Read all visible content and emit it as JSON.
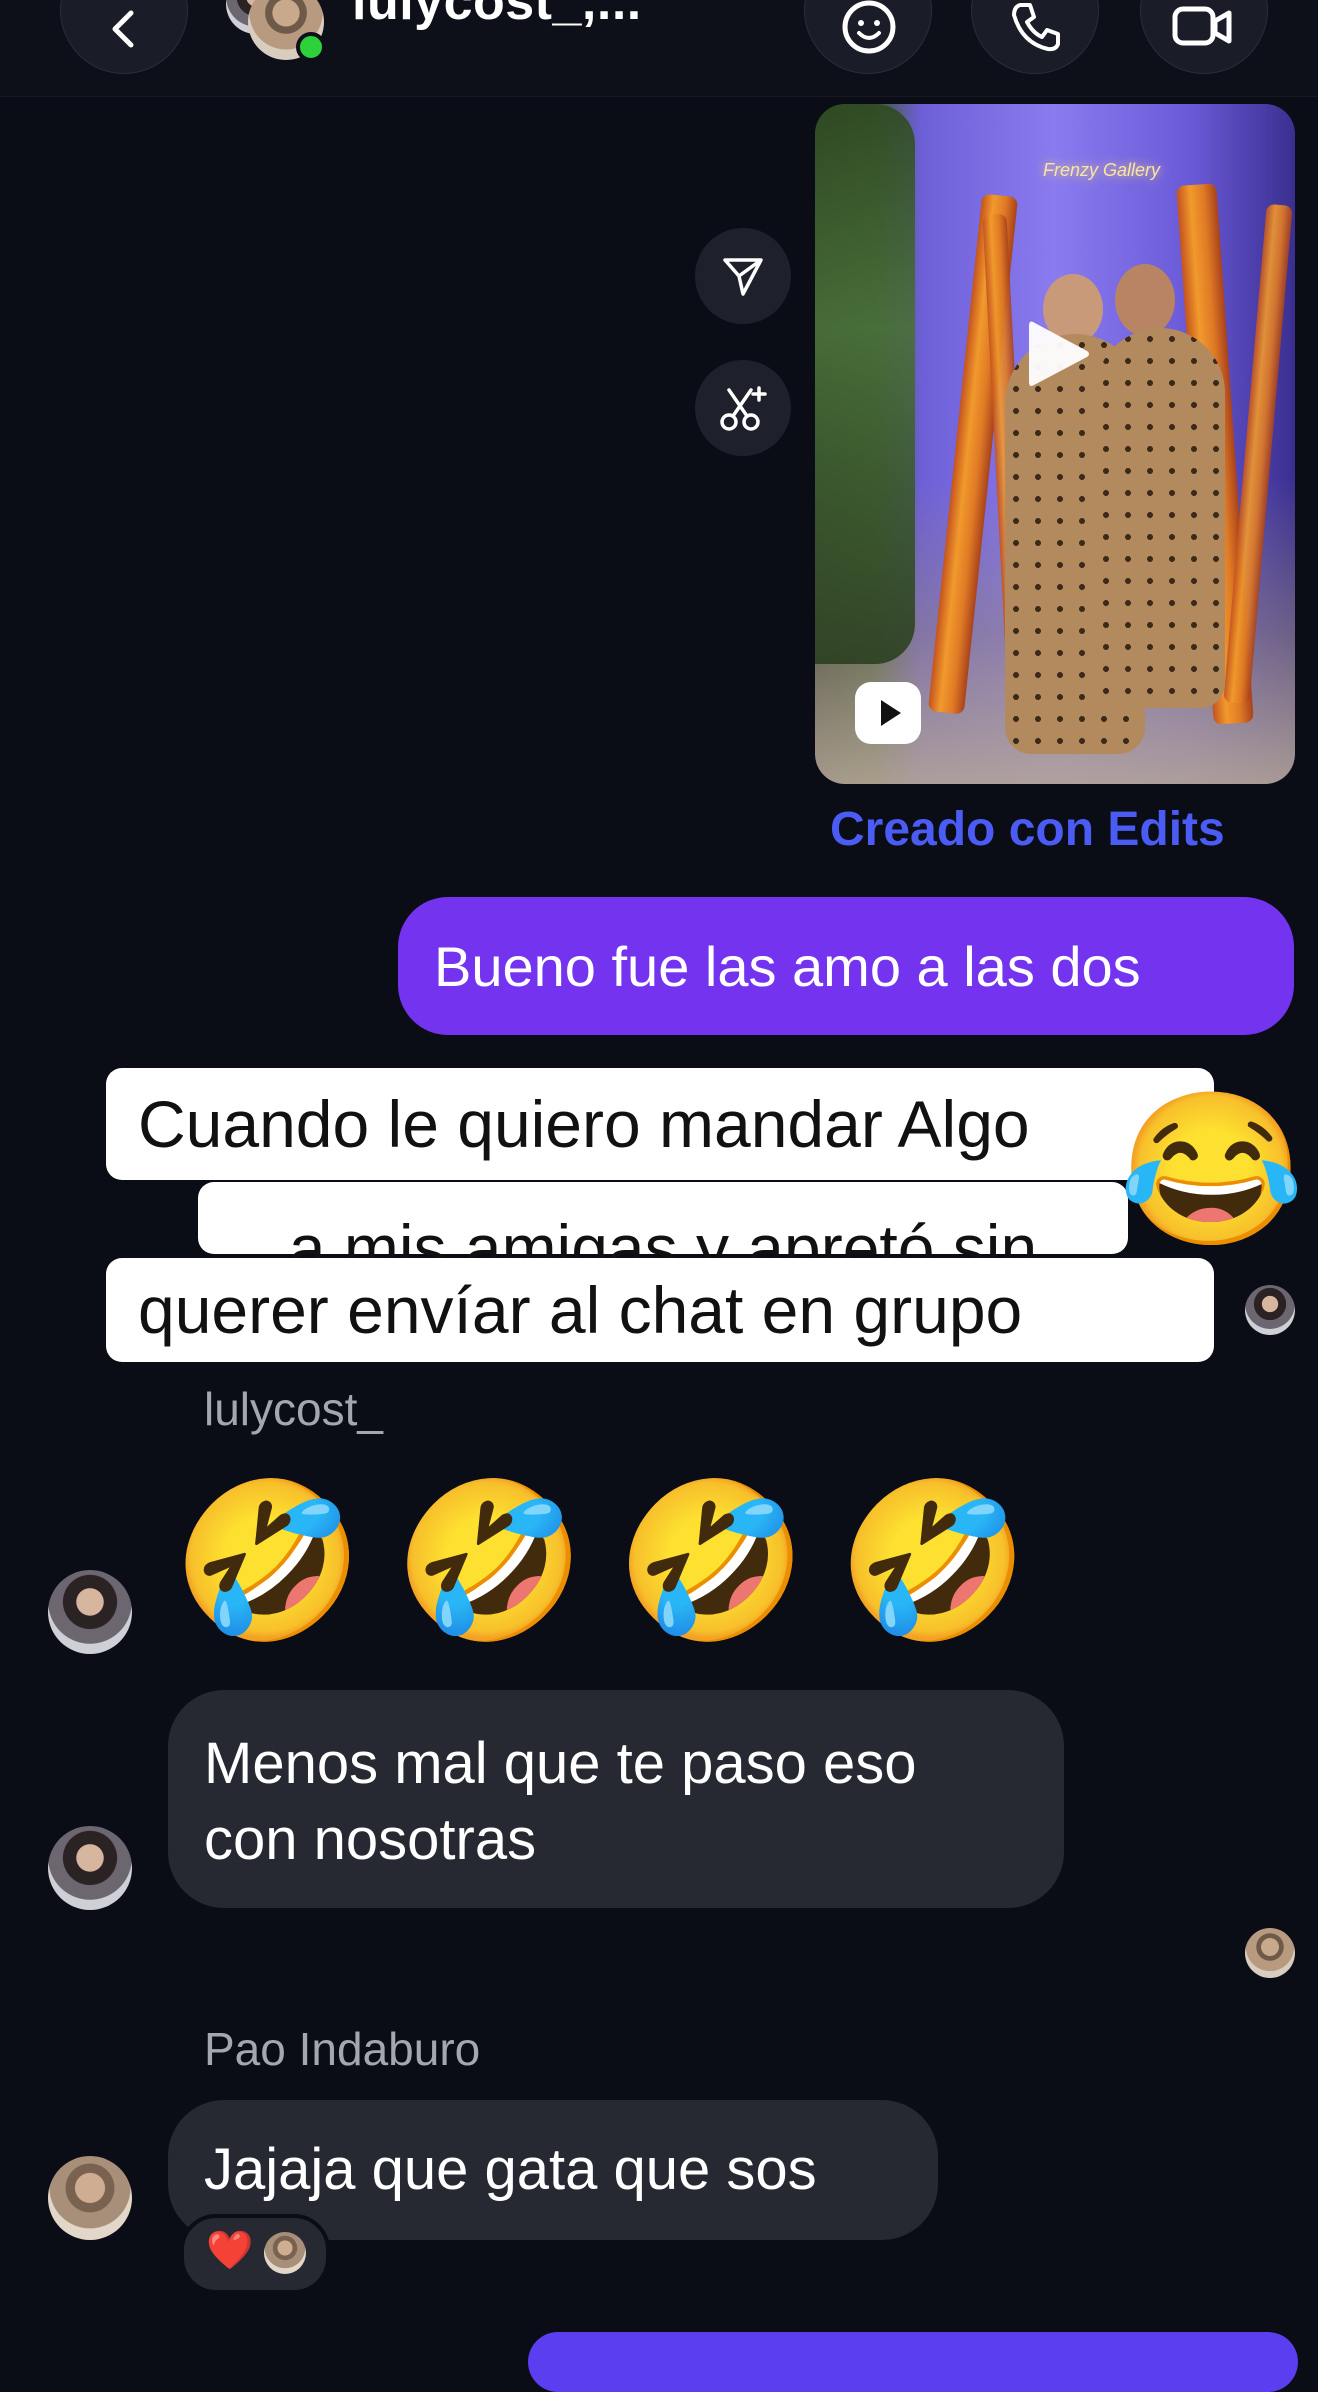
{
  "header": {
    "contact_name": "lulycost_,...",
    "back_icon": "chevron-left-icon",
    "buttons": [
      "sticker-icon",
      "phone-icon",
      "video-camera-icon"
    ],
    "online_color": "#2dd23a"
  },
  "video_message": {
    "sign_text": "Frenzy Gallery",
    "side_actions": [
      "send-icon",
      "scissors-icon"
    ],
    "caption": "Creado con Edits"
  },
  "messages": {
    "outgoing_1": "Bueno fue las amo a las dos",
    "sticker_lines": [
      "Cuando le quiero mandar Algo",
      "a mis amigas y apretó sin",
      "querer envíar al chat en grupo"
    ],
    "sticker_emoji": "😂",
    "sender_1": "lulycost_",
    "emoji_message": "🤣🤣🤣🤣",
    "incoming_1": "Menos mal que te paso eso con nosotras",
    "sender_2": "Pao Indaburo",
    "incoming_2": "Jajaja que gata que sos",
    "reaction": "❤️"
  },
  "colors": {
    "background": "#0b0d16",
    "outgoing_bubble": "#7433ee",
    "incoming_bubble": "#262931",
    "link": "#4a5cf4"
  }
}
